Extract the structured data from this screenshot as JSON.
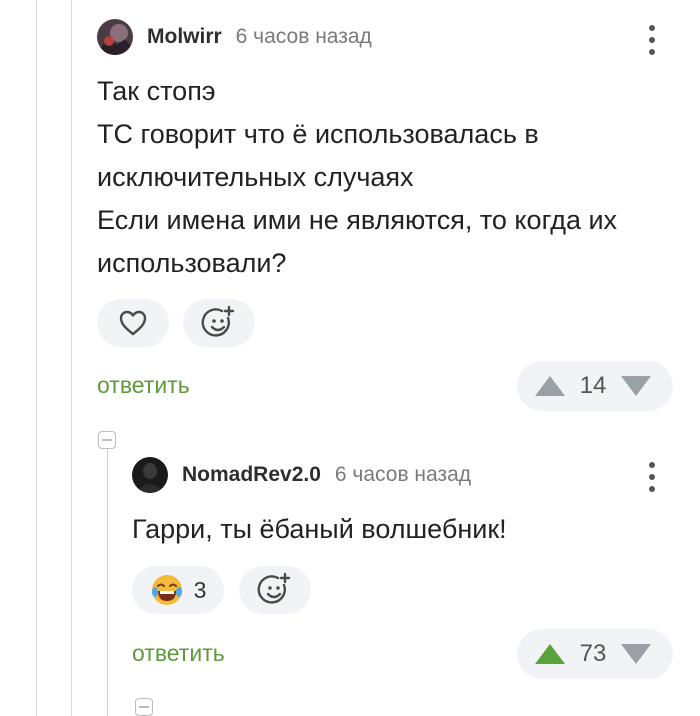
{
  "comments": [
    {
      "author": "Molwirr",
      "time": "6 часов назад",
      "lines": [
        "Так стопэ",
        "ТС говорит что ё использовалась в",
        "исключительных случаях",
        "Если имена ими не являются, то когда их",
        "использовали?"
      ],
      "reply_label": "ответить",
      "rating": "14",
      "upvote_color": "#9aa0a6",
      "downvote_color": "#9aa0a6"
    },
    {
      "author": "NomadRev2.0",
      "time": "6 часов назад",
      "lines": [
        "Гарри, ты ёбаный волшебник!"
      ],
      "reaction_count": "3",
      "reply_label": "ответить",
      "rating": "73",
      "upvote_color": "#5aa23a",
      "downvote_color": "#9aa0a6"
    }
  ],
  "icons": {
    "like": "heart-icon",
    "add_reaction": "add-emoji-icon",
    "reaction": "laughing-emoji-icon",
    "upvote": "upvote-arrow-icon",
    "downvote": "downvote-arrow-icon",
    "menu": "more-vertical-icon",
    "collapse": "collapse-icon"
  },
  "colors": {
    "accent_green": "#5f9a3a",
    "pill_bg": "#f1f3f6",
    "muted_text": "#7a7a7a"
  }
}
